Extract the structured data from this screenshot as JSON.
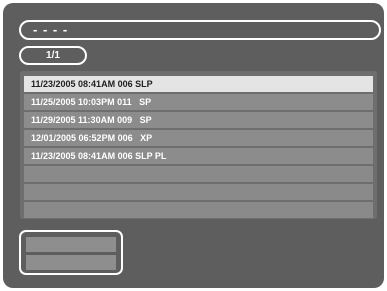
{
  "header": {
    "title": "- - - -"
  },
  "pager": {
    "label": "1/1"
  },
  "list": {
    "rows": [
      {
        "text": "11/23/2005 08:41AM 006 SLP",
        "selected": true
      },
      {
        "text": "11/25/2005 10:03PM 011   SP",
        "selected": false
      },
      {
        "text": "11/29/2005 11:30AM 009   SP",
        "selected": false
      },
      {
        "text": "12/01/2005 06:52PM 006   XP",
        "selected": false
      },
      {
        "text": "11/23/2005 08:41AM 006 SLP PL",
        "selected": false
      },
      {
        "text": "",
        "selected": false
      },
      {
        "text": "",
        "selected": false
      },
      {
        "text": "",
        "selected": false
      }
    ]
  },
  "buttons": [
    {
      "label": ""
    },
    {
      "label": ""
    }
  ],
  "colors": {
    "screen_bg": "#5e5e5e",
    "row_bg": "#8c8c8c",
    "row_selected_bg": "#e4e4e4",
    "border": "#ffffff"
  }
}
